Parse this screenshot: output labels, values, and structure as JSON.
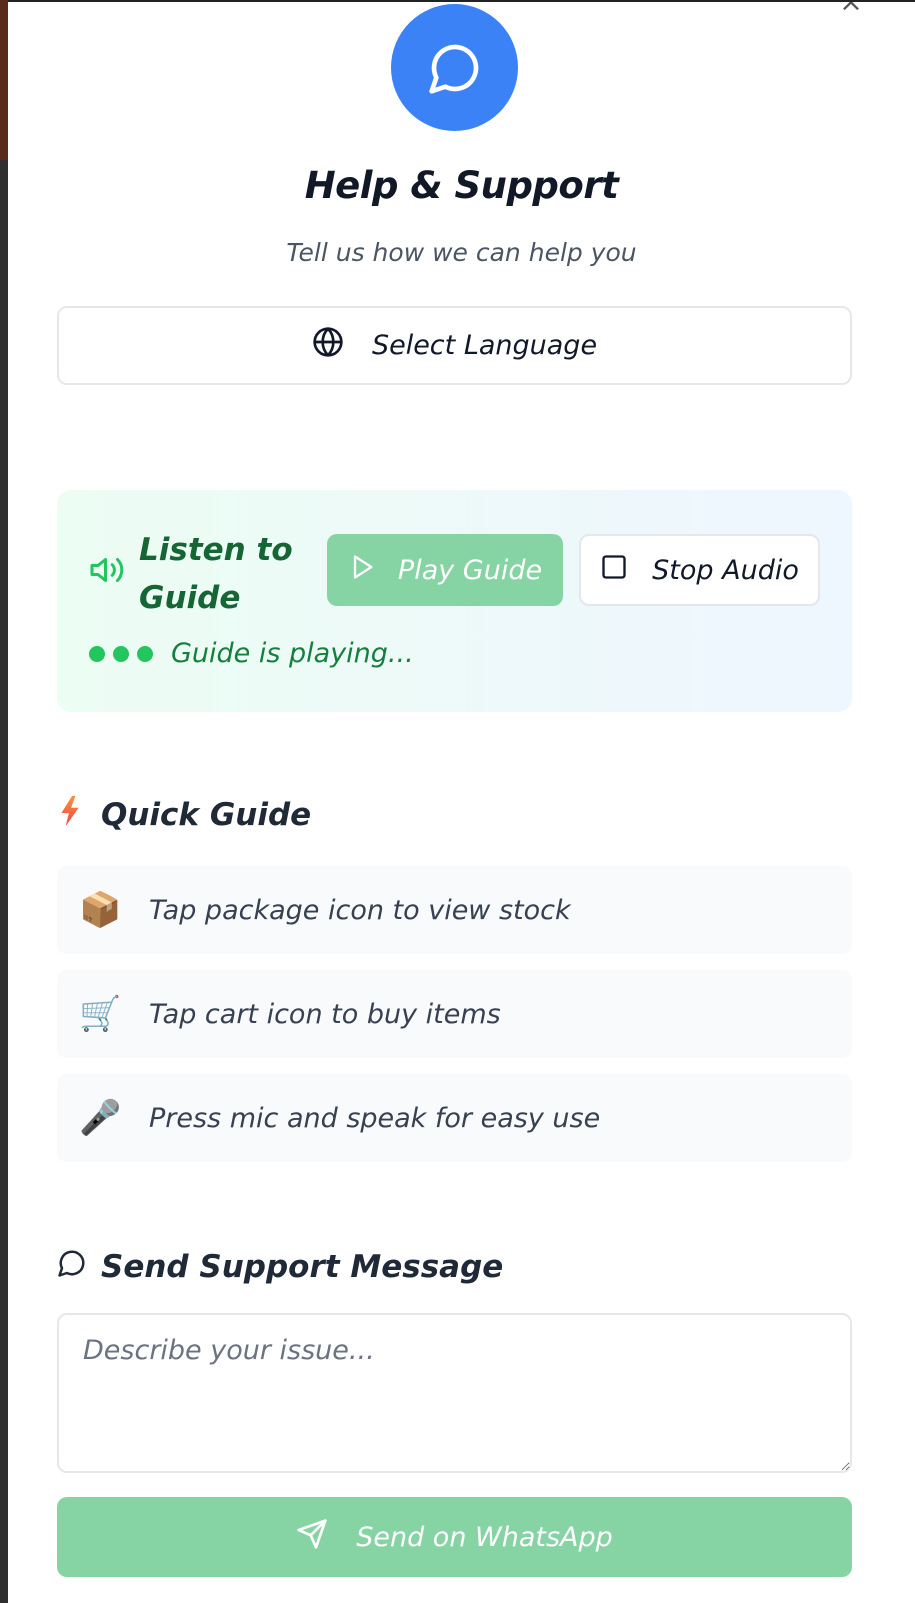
{
  "modal": {
    "close_symbol": "×",
    "hero_icon": "chat-bubble-icon",
    "title": "Help & Support",
    "subtitle": "Tell us how we can help you"
  },
  "language": {
    "icon": "globe-icon",
    "label": "Select Language"
  },
  "audio_guide": {
    "label": "Listen to Guide",
    "play_label": "Play Guide",
    "stop_label": "Stop Audio",
    "status": "Guide is playing..."
  },
  "quick_guide": {
    "title": "Quick Guide",
    "items": [
      {
        "emoji": "📦",
        "text": "Tap package icon to view stock"
      },
      {
        "emoji": "🛒",
        "text": "Tap cart icon to buy items"
      },
      {
        "emoji": "🎤",
        "text": "Press mic and speak for easy use"
      }
    ]
  },
  "support": {
    "title": "Send Support Message",
    "placeholder": "Describe your issue...",
    "send_label": "Send on WhatsApp"
  },
  "colors": {
    "accent_blue": "#3b82f6",
    "green_button": "#86d3a3",
    "green_text": "#166534"
  }
}
